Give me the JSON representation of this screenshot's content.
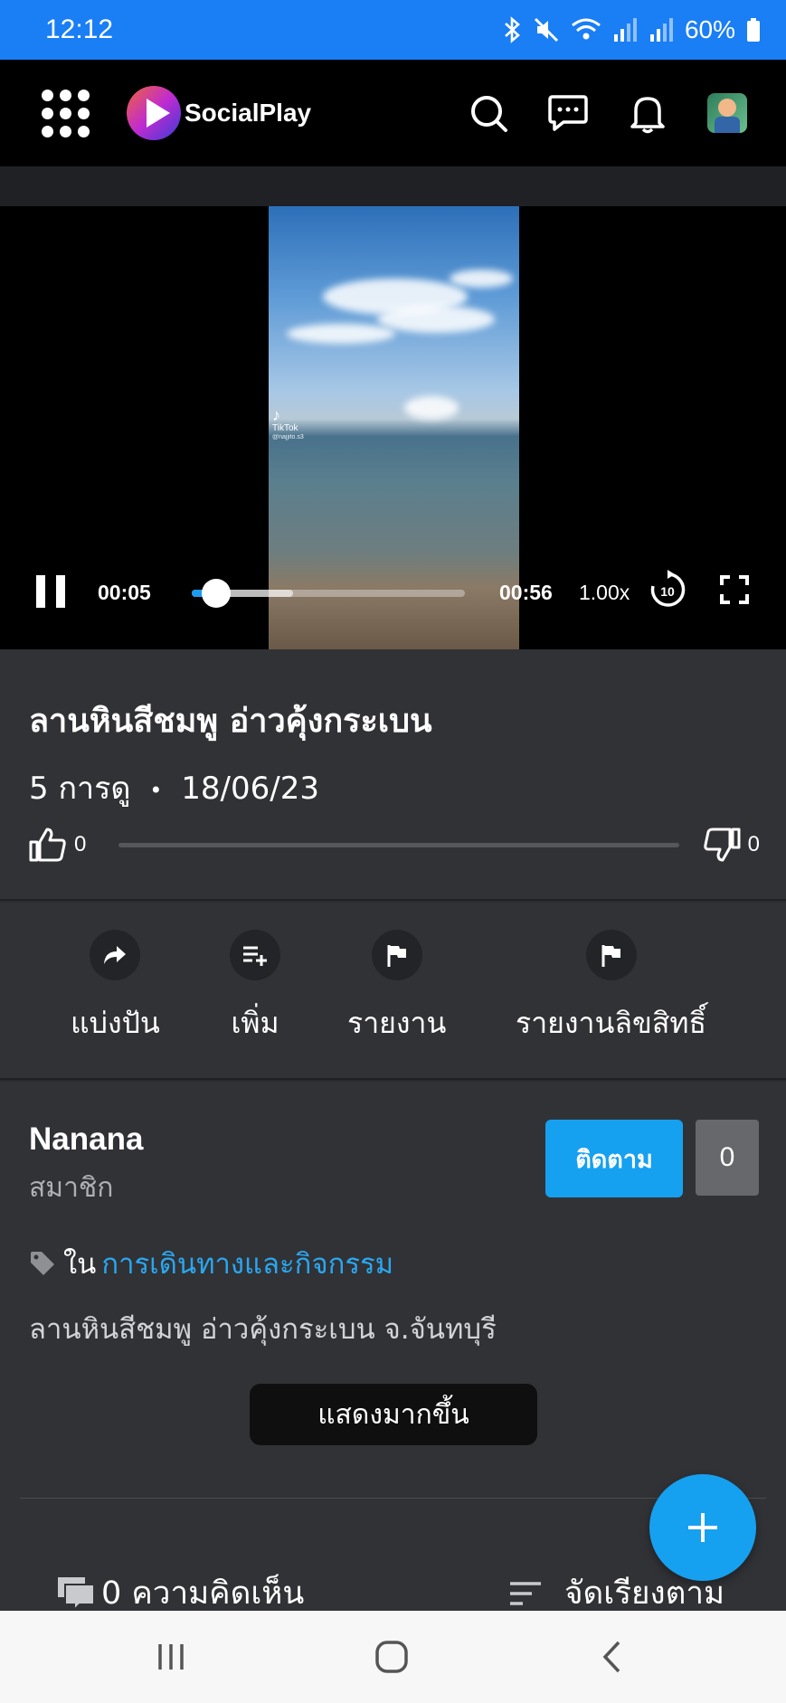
{
  "status_bar": {
    "time": "12:12",
    "battery": "60%"
  },
  "app": {
    "name": "SocialPlay"
  },
  "player": {
    "current_time": "00:05",
    "duration": "00:56",
    "speed": "1.00x",
    "progress_fraction": 0.09,
    "buffered_fraction": 0.37,
    "watermark": {
      "brand": "TikTok",
      "user": "@najjito.s3"
    }
  },
  "video": {
    "title": "ลานหินสีชมพู อ่าวคุ้งกระเบน",
    "views": "5 การดู",
    "separator": "•",
    "date": "18/06/23",
    "likes": "0",
    "dislikes": "0"
  },
  "actions": [
    {
      "label": "แบ่งปัน",
      "icon": "share-icon"
    },
    {
      "label": "เพิ่ม",
      "icon": "playlist-add-icon"
    },
    {
      "label": "รายงาน",
      "icon": "flag-icon"
    },
    {
      "label": "รายงานลิขสิทธิ์",
      "icon": "flag-icon"
    }
  ],
  "channel": {
    "name": "Nanana",
    "role": "สมาชิก",
    "follow_label": "ติดตาม",
    "follower_count": "0",
    "category_prefix": "ใน",
    "category": "การเดินทางและกิจกรรม",
    "description": "ลานหินสีชมพู อ่าวคุ้งกระเบน จ.จันทบุรี",
    "show_more": "แสดงมากขึ้น"
  },
  "comments": {
    "count_label": "0 ความคิดเห็น",
    "sort_label": "จัดเรียงตาม"
  },
  "colors": {
    "accent": "#16a0f0",
    "status_bar": "#1a7ef5",
    "surface": "#313236"
  }
}
